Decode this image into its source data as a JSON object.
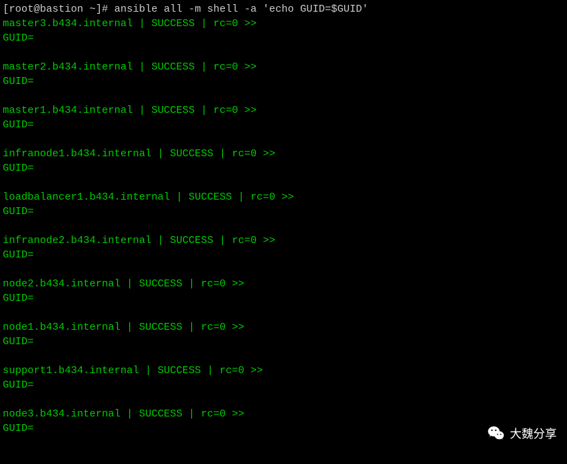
{
  "prompt": "[root@bastion ~]# ansible all -m shell -a 'echo GUID=$GUID'",
  "hosts": [
    {
      "name": "master3.b434.internal",
      "status": "SUCCESS",
      "rc": "rc=0",
      "guid": "GUID="
    },
    {
      "name": "master2.b434.internal",
      "status": "SUCCESS",
      "rc": "rc=0",
      "guid": "GUID="
    },
    {
      "name": "master1.b434.internal",
      "status": "SUCCESS",
      "rc": "rc=0",
      "guid": "GUID="
    },
    {
      "name": "infranode1.b434.internal",
      "status": "SUCCESS",
      "rc": "rc=0",
      "guid": "GUID="
    },
    {
      "name": "loadbalancer1.b434.internal",
      "status": "SUCCESS",
      "rc": "rc=0",
      "guid": "GUID="
    },
    {
      "name": "infranode2.b434.internal",
      "status": "SUCCESS",
      "rc": "rc=0",
      "guid": "GUID="
    },
    {
      "name": "node2.b434.internal",
      "status": "SUCCESS",
      "rc": "rc=0",
      "guid": "GUID="
    },
    {
      "name": "node1.b434.internal",
      "status": "SUCCESS",
      "rc": "rc=0",
      "guid": "GUID="
    },
    {
      "name": "support1.b434.internal",
      "status": "SUCCESS",
      "rc": "rc=0",
      "guid": "GUID="
    },
    {
      "name": "node3.b434.internal",
      "status": "SUCCESS",
      "rc": "rc=0",
      "guid": "GUID="
    }
  ],
  "separator": " | ",
  "arrow": " >>",
  "watermark_text": "大魏分享"
}
